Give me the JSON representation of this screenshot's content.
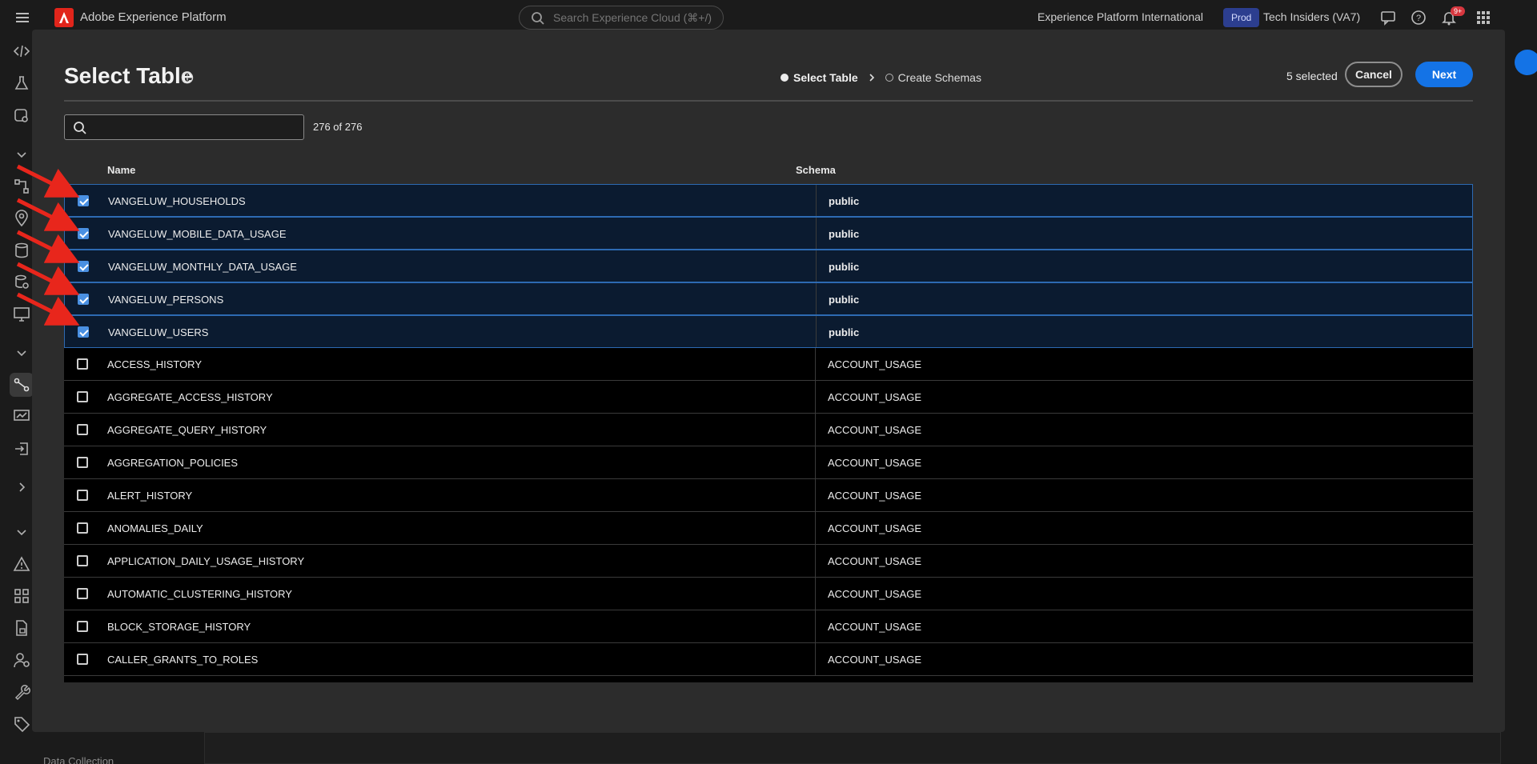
{
  "topbar": {
    "app_title": "Adobe Experience Platform",
    "search_placeholder": "Search Experience Cloud (⌘+/)",
    "org_name": "Experience Platform International",
    "env_badge": "Prod",
    "sandbox_name": "Tech Insiders (VA7)",
    "notification_count": "9+"
  },
  "background": {
    "bottom_label": "Data Collection"
  },
  "modal": {
    "title": "Select Table",
    "steps": [
      {
        "label": "Select Table",
        "state": "current"
      },
      {
        "label": "Create Schemas",
        "state": "pending"
      }
    ],
    "selected_count": "5 selected",
    "cancel_label": "Cancel",
    "next_label": "Next",
    "search_value": "",
    "result_count": "276 of 276",
    "columns": {
      "name": "Name",
      "schema": "Schema"
    },
    "rows": [
      {
        "name": "VANGELUW_HOUSEHOLDS",
        "schema": "public",
        "selected": true
      },
      {
        "name": "VANGELUW_MOBILE_DATA_USAGE",
        "schema": "public",
        "selected": true
      },
      {
        "name": "VANGELUW_MONTHLY_DATA_USAGE",
        "schema": "public",
        "selected": true
      },
      {
        "name": "VANGELUW_PERSONS",
        "schema": "public",
        "selected": true
      },
      {
        "name": "VANGELUW_USERS",
        "schema": "public",
        "selected": true
      },
      {
        "name": "ACCESS_HISTORY",
        "schema": "ACCOUNT_USAGE",
        "selected": false
      },
      {
        "name": "AGGREGATE_ACCESS_HISTORY",
        "schema": "ACCOUNT_USAGE",
        "selected": false
      },
      {
        "name": "AGGREGATE_QUERY_HISTORY",
        "schema": "ACCOUNT_USAGE",
        "selected": false
      },
      {
        "name": "AGGREGATION_POLICIES",
        "schema": "ACCOUNT_USAGE",
        "selected": false
      },
      {
        "name": "ALERT_HISTORY",
        "schema": "ACCOUNT_USAGE",
        "selected": false
      },
      {
        "name": "ANOMALIES_DAILY",
        "schema": "ACCOUNT_USAGE",
        "selected": false
      },
      {
        "name": "APPLICATION_DAILY_USAGE_HISTORY",
        "schema": "ACCOUNT_USAGE",
        "selected": false
      },
      {
        "name": "AUTOMATIC_CLUSTERING_HISTORY",
        "schema": "ACCOUNT_USAGE",
        "selected": false
      },
      {
        "name": "BLOCK_STORAGE_HISTORY",
        "schema": "ACCOUNT_USAGE",
        "selected": false
      },
      {
        "name": "CALLER_GRANTS_TO_ROLES",
        "schema": "ACCOUNT_USAGE",
        "selected": false
      }
    ]
  },
  "colors": {
    "accent": "#1473e6",
    "selected_row_bg": "#0b1b30",
    "selected_row_border": "#2d6ab2",
    "annotation_arrow": "#e8261c"
  }
}
